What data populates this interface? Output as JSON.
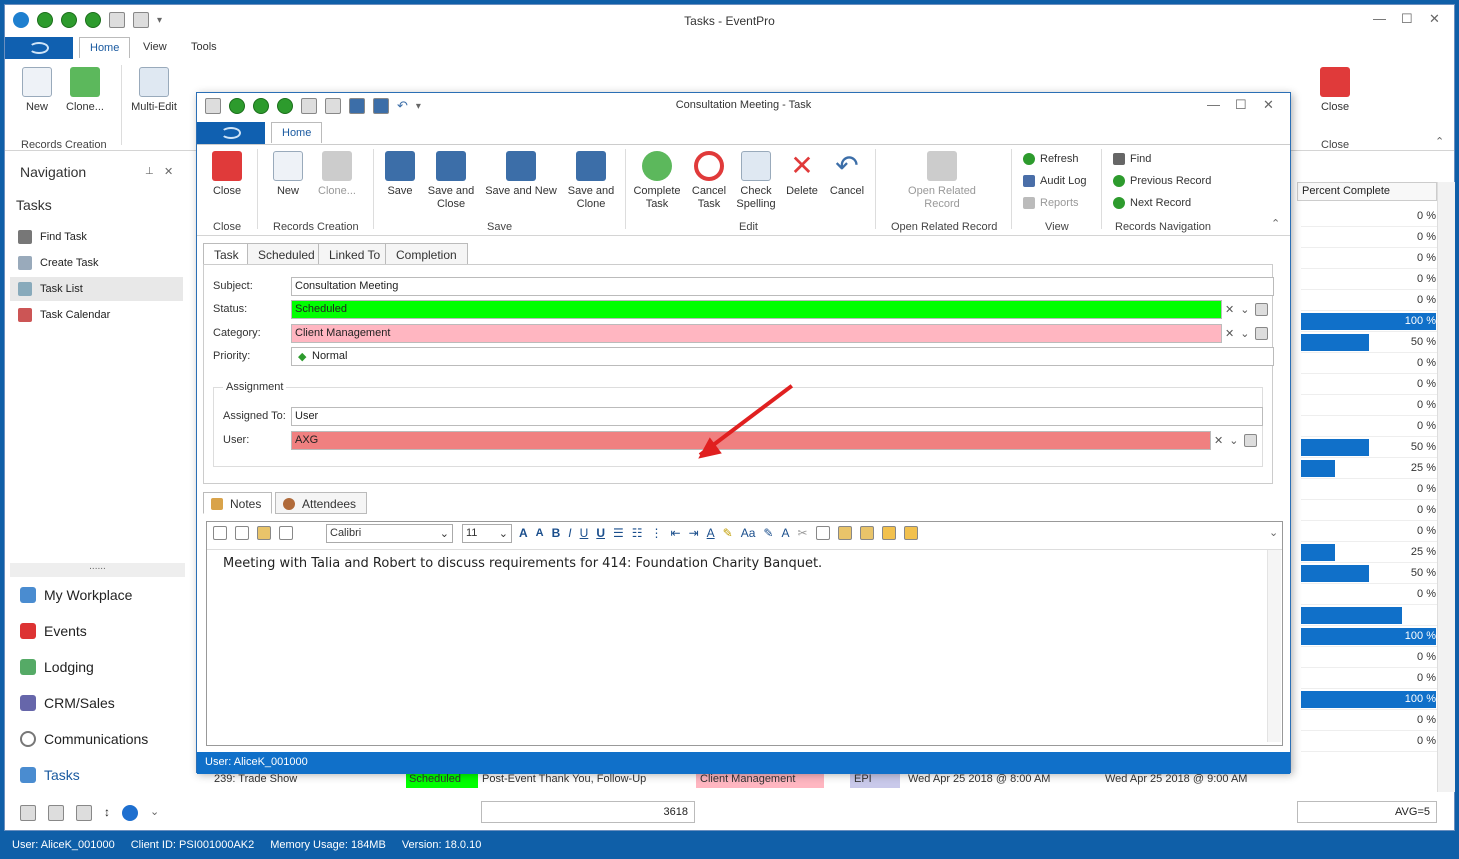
{
  "app": {
    "window_title": "Tasks - EventPro",
    "tabs": [
      "Home",
      "View",
      "Tools"
    ]
  },
  "main_ribbon": {
    "buttons": {
      "new": "New",
      "clone": "Clone...",
      "multi_edit": "Multi-Edit",
      "close": "Close"
    },
    "groups": {
      "records_creation": "Records Creation",
      "close": "Close"
    }
  },
  "navigation": {
    "title": "Navigation",
    "section": "Tasks",
    "items": [
      "Find Task",
      "Create Task",
      "Task List",
      "Task Calendar"
    ],
    "handle": "......",
    "modules": [
      "My Workplace",
      "Events",
      "Lodging",
      "CRM/Sales",
      "Communications",
      "Tasks"
    ]
  },
  "grid": {
    "header": "Percent Complete",
    "percent_complete": [
      0,
      0,
      0,
      0,
      0,
      100,
      50,
      0,
      0,
      0,
      0,
      50,
      25,
      0,
      0,
      0,
      25,
      50,
      0,
      75,
      100,
      0,
      0,
      100,
      0,
      0
    ],
    "labels": [
      "0 %",
      "0 %",
      "0 %",
      "0 %",
      "0 %",
      "100 %",
      "50 %",
      "0 %",
      "0 %",
      "0 %",
      "0 %",
      "50 %",
      "25 %",
      "0 %",
      "0 %",
      "0 %",
      "25 %",
      "50 %",
      "0 %",
      "75 %",
      "100 %",
      "0 %",
      "0 %",
      "100 %",
      "0 %",
      "0 %"
    ],
    "bottom_row": {
      "subject": "239: Trade Show",
      "status": "Scheduled",
      "description": "Post-Event Thank You, Follow-Up",
      "category": "Client Management",
      "priority": "EPI",
      "start": "Wed Apr 25 2018 @ 8:00 AM",
      "end": "Wed Apr 25 2018 @ 9:00 AM"
    },
    "count": "3618",
    "avg": "AVG=5"
  },
  "status_bar": {
    "user": "User: AliceK_001000",
    "client": "Client ID: PSI001000AK2",
    "memory": "Memory Usage: 184MB",
    "version": "Version: 18.0.10"
  },
  "dialog": {
    "title": "Consultation Meeting - Task",
    "tab": "Home",
    "ribbon": {
      "close": "Close",
      "new": "New",
      "clone": "Clone...",
      "save": "Save",
      "save_and_close": "Save and Close",
      "save_and_new": "Save and New",
      "save_and_clone": "Save and Clone",
      "complete_task": "Complete Task",
      "cancel_task": "Cancel Task",
      "check_spelling": "Check Spelling",
      "delete": "Delete",
      "cancel": "Cancel",
      "open_related_record": "Open Related Record",
      "refresh": "Refresh",
      "audit_log": "Audit Log",
      "reports": "Reports",
      "find": "Find",
      "previous_record": "Previous Record",
      "next_record": "Next Record",
      "groups": [
        "Close",
        "Records Creation",
        "Save",
        "Edit",
        "Open Related Record",
        "View",
        "Records Navigation"
      ]
    },
    "form_tabs": [
      "Task",
      "Scheduled",
      "Linked To",
      "Completion"
    ],
    "fields": {
      "subject_label": "Subject:",
      "subject": "Consultation Meeting",
      "status_label": "Status:",
      "status": "Scheduled",
      "category_label": "Category:",
      "category": "Client Management",
      "priority_label": "Priority:",
      "priority": "Normal",
      "assignment_label": "Assignment",
      "assigned_to_label": "Assigned To:",
      "assigned_to": "User",
      "user_label": "User:",
      "user": "AXG"
    },
    "bottom_tabs": [
      "Notes",
      "Attendees"
    ],
    "editor": {
      "font": "Calibri",
      "size": "11",
      "text": "Meeting with Talia and Robert to discuss requirements for 414: Foundation Charity Banquet."
    },
    "status": "User: AliceK_001000"
  },
  "colors": {
    "status_green": "#00ff00",
    "category_pink": "#ffb6c1",
    "user_red": "#f08080",
    "accent_blue": "#1070c9",
    "arrow_red": "#e02020"
  }
}
